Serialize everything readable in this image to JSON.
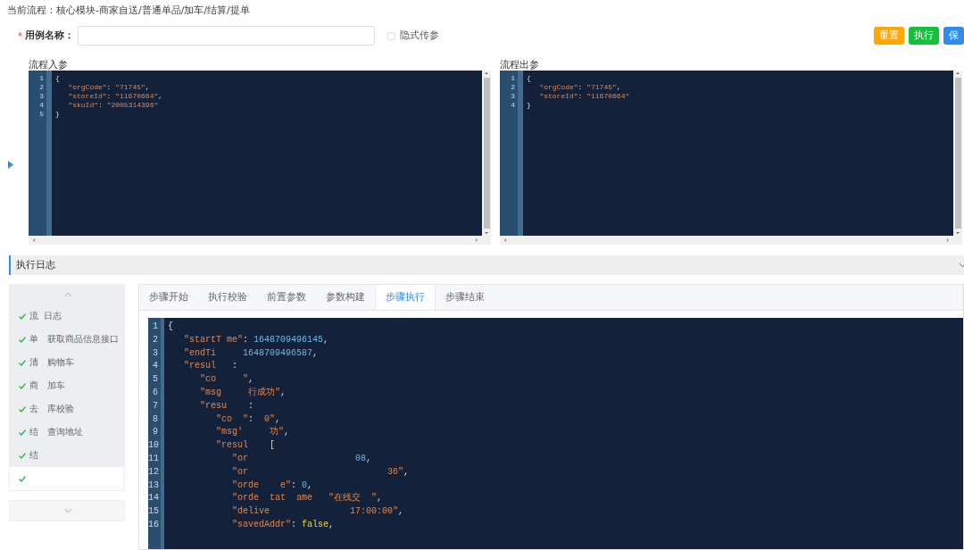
{
  "flow_title": "当前流程：核心模块-商家自送/普通单品/加车/结算/提单",
  "case_name": {
    "required_mark": "*",
    "label": "用例名称："
  },
  "implicit_params": {
    "label": "隐式传参",
    "checked": false
  },
  "buttons": [
    {
      "label": "重置",
      "color": "#ffa700"
    },
    {
      "label": "执行",
      "color": "#13c23a"
    },
    {
      "label": "保",
      "color": "#2d8cf0"
    }
  ],
  "input_editor": {
    "label": "流程入参",
    "lines": [
      {
        "num": "1",
        "parts": [
          {
            "kind": "punct",
            "text": "{"
          }
        ]
      },
      {
        "num": "2",
        "parts": [
          {
            "kind": "string",
            "text": "   \"orgCode\""
          },
          {
            "kind": "punct",
            "text": ": "
          },
          {
            "kind": "string",
            "text": "\"71745\""
          },
          {
            "kind": "punct",
            "text": ","
          }
        ]
      },
      {
        "num": "3",
        "parts": [
          {
            "kind": "string",
            "text": "   \"storeId\""
          },
          {
            "kind": "punct",
            "text": ": "
          },
          {
            "kind": "string",
            "text": "\"11670664\""
          },
          {
            "kind": "punct",
            "text": ","
          }
        ]
      },
      {
        "num": "4",
        "parts": [
          {
            "kind": "string",
            "text": "   \"skuId\""
          },
          {
            "kind": "punct",
            "text": ": "
          },
          {
            "kind": "string",
            "text": "\"2005314396\""
          }
        ]
      },
      {
        "num": "5",
        "parts": [
          {
            "kind": "punct",
            "text": "}"
          }
        ]
      }
    ]
  },
  "output_editor": {
    "label": "流程出参",
    "lines": [
      {
        "num": "1",
        "parts": [
          {
            "kind": "punct",
            "text": "{"
          }
        ]
      },
      {
        "num": "2",
        "parts": [
          {
            "kind": "string",
            "text": "   \"orgCode\""
          },
          {
            "kind": "punct",
            "text": ": "
          },
          {
            "kind": "string",
            "text": "\"71745\""
          },
          {
            "kind": "punct",
            "text": ","
          }
        ]
      },
      {
        "num": "3",
        "parts": [
          {
            "kind": "string",
            "text": "   \"storeId\""
          },
          {
            "kind": "punct",
            "text": ": "
          },
          {
            "kind": "string",
            "text": "\"11670664\""
          }
        ]
      },
      {
        "num": "4",
        "parts": [
          {
            "kind": "punct",
            "text": "}"
          }
        ]
      }
    ]
  },
  "log_section": {
    "title": "执行日志",
    "expanded": true
  },
  "steps": [
    {
      "label": "流  日志",
      "done": true,
      "selected": false
    },
    {
      "label": "单   获取商品信息接口",
      "done": true,
      "selected": false
    },
    {
      "label": "清   购物车",
      "done": true,
      "selected": false
    },
    {
      "label": "商   加车",
      "done": true,
      "selected": false
    },
    {
      "label": "去   库校验",
      "done": true,
      "selected": false
    },
    {
      "label": "结   查询地址",
      "done": true,
      "selected": false
    },
    {
      "label": "结",
      "done": true,
      "selected": false
    },
    {
      "done": true,
      "selected": true
    }
  ],
  "tabs": [
    {
      "label": "步骤开始",
      "selected": false
    },
    {
      "label": "执行校验",
      "selected": false
    },
    {
      "label": "前置参数",
      "selected": false
    },
    {
      "label": "参数构建",
      "selected": false
    },
    {
      "label": "步骤执行",
      "selected": true
    },
    {
      "label": "步骤结束",
      "selected": false
    }
  ],
  "result_editor": {
    "lines": [
      {
        "num": "1",
        "parts": [
          {
            "kind": "punct",
            "text": "{"
          }
        ]
      },
      {
        "num": "2",
        "parts": [
          {
            "kind": "string",
            "text": "   \"startT me\""
          },
          {
            "kind": "punct",
            "text": ": "
          },
          {
            "kind": "number",
            "text": "1648709496145"
          },
          {
            "kind": "punct",
            "text": ","
          }
        ]
      },
      {
        "num": "3",
        "parts": [
          {
            "kind": "string",
            "text": "   \"endTi     "
          },
          {
            "kind": "number",
            "text": "1648709496587"
          },
          {
            "kind": "punct",
            "text": ","
          }
        ]
      },
      {
        "num": "4",
        "parts": [
          {
            "kind": "string",
            "text": "   \"resul"
          },
          {
            "kind": "punct",
            "text": "   :"
          }
        ]
      },
      {
        "num": "5",
        "parts": [
          {
            "kind": "string",
            "text": "      \"co     \""
          },
          {
            "kind": "punct",
            "text": ","
          }
        ]
      },
      {
        "num": "6",
        "parts": [
          {
            "kind": "string",
            "text": "      \"msg     行成功\""
          },
          {
            "kind": "punct",
            "text": ","
          }
        ]
      },
      {
        "num": "7",
        "parts": [
          {
            "kind": "string",
            "text": "      \"resu"
          },
          {
            "kind": "punct",
            "text": "    :"
          }
        ]
      },
      {
        "num": "8",
        "parts": [
          {
            "kind": "string",
            "text": "         \"co  \""
          },
          {
            "kind": "punct",
            "text": ":  "
          },
          {
            "kind": "string",
            "text": "0\""
          },
          {
            "kind": "punct",
            "text": ","
          }
        ]
      },
      {
        "num": "9",
        "parts": [
          {
            "kind": "string",
            "text": "         \"msg'     功\""
          },
          {
            "kind": "punct",
            "text": ","
          }
        ]
      },
      {
        "num": "10",
        "parts": [
          {
            "kind": "string",
            "text": "         \"resul"
          },
          {
            "kind": "punct",
            "text": "    ["
          }
        ]
      },
      {
        "num": "11",
        "parts": [
          {
            "kind": "string",
            "text": "            \"or                    "
          },
          {
            "kind": "number",
            "text": "08"
          },
          {
            "kind": "punct",
            "text": ","
          }
        ]
      },
      {
        "num": "12",
        "parts": [
          {
            "kind": "string",
            "text": "            \"or                          36\""
          },
          {
            "kind": "punct",
            "text": ","
          }
        ]
      },
      {
        "num": "13",
        "parts": [
          {
            "kind": "string",
            "text": "            \"orde    e\""
          },
          {
            "kind": "punct",
            "text": ": "
          },
          {
            "kind": "number",
            "text": "0"
          },
          {
            "kind": "punct",
            "text": ","
          }
        ]
      },
      {
        "num": "14",
        "parts": [
          {
            "kind": "string",
            "text": "            \"orde  tat  ame   \"在线交  \""
          },
          {
            "kind": "punct",
            "text": ","
          }
        ]
      },
      {
        "num": "15",
        "parts": [
          {
            "kind": "string",
            "text": "            \"delive               17:00:00\""
          },
          {
            "kind": "punct",
            "text": ","
          }
        ]
      },
      {
        "num": "16",
        "parts": [
          {
            "kind": "string",
            "text": "            \"savedAddr\""
          },
          {
            "kind": "punct",
            "text": ": "
          },
          {
            "kind": "bool",
            "text": "false"
          },
          {
            "kind": "punct",
            "text": ","
          }
        ]
      }
    ]
  }
}
